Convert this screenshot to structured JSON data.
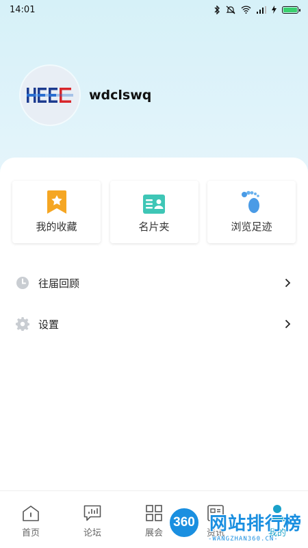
{
  "status_bar": {
    "time": "14:01"
  },
  "profile": {
    "username": "wdclswq",
    "avatar_logo_text": "HEEC"
  },
  "quick_actions": [
    {
      "label": "我的收藏",
      "icon": "bookmark-star-icon"
    },
    {
      "label": "名片夹",
      "icon": "business-card-icon"
    },
    {
      "label": "浏览足迹",
      "icon": "footprint-icon"
    }
  ],
  "menu": [
    {
      "label": "往届回顾",
      "icon": "clock-icon"
    },
    {
      "label": "设置",
      "icon": "gear-icon"
    }
  ],
  "tabs": [
    {
      "label": "首页",
      "icon": "home-icon"
    },
    {
      "label": "论坛",
      "icon": "forum-chart-icon"
    },
    {
      "label": "展会",
      "icon": "grid-icon"
    },
    {
      "label": "资讯",
      "icon": "news-icon"
    },
    {
      "label": "我的",
      "icon": "person-icon"
    }
  ],
  "active_tab": "我的",
  "watermark": {
    "badge": "360",
    "title": "网站排行榜",
    "url": "-WANGZHAN360.CN-"
  },
  "colors": {
    "accent": "#1aa1c9",
    "header_bg": "#d6f1f8",
    "bookmark": "#f5a623",
    "card": "#3ec6b6",
    "foot": "#4a9be6"
  }
}
